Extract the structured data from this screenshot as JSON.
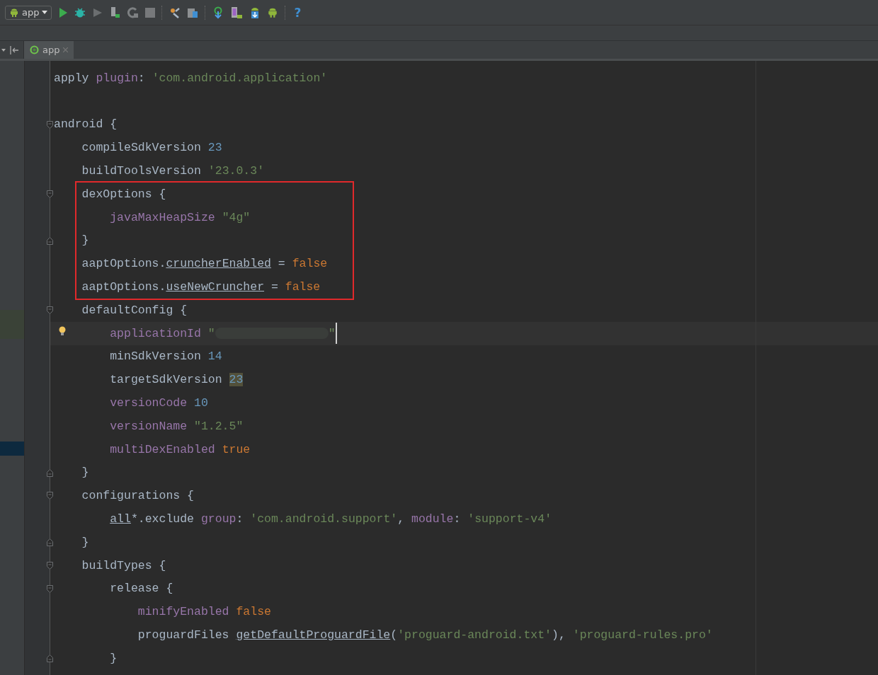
{
  "toolbar": {
    "run_config": "app",
    "help": "?"
  },
  "tabs": [
    {
      "label": "app",
      "selected": true
    }
  ],
  "editor": {
    "lines": [
      {
        "kind": "code",
        "tokens": [
          {
            "kind": "plain",
            "text": "apply "
          },
          {
            "kind": "field",
            "text": "plugin"
          },
          {
            "kind": "plain",
            "text": ": "
          },
          {
            "kind": "string",
            "text": "'com.android.application'"
          }
        ]
      },
      {
        "kind": "blank"
      },
      {
        "kind": "code",
        "tokens": [
          {
            "kind": "plain",
            "text": "android {"
          }
        ],
        "children": [
          {
            "kind": "code",
            "tokens": [
              {
                "kind": "plain",
                "text": "compileSdkVersion "
              },
              {
                "kind": "number",
                "text": "23"
              }
            ]
          },
          {
            "kind": "code",
            "tokens": [
              {
                "kind": "plain",
                "text": "buildToolsVersion "
              },
              {
                "kind": "string",
                "text": "'23.0.3'"
              }
            ]
          },
          {
            "kind": "highlight",
            "children": [
              {
                "kind": "code",
                "tokens": [
                  {
                    "kind": "plain",
                    "text": "dexOptions {"
                  }
                ],
                "closing": "}",
                "children": [
                  {
                    "kind": "code",
                    "tokens": [
                      {
                        "kind": "field",
                        "text": "javaMaxHeapSize "
                      },
                      {
                        "kind": "string",
                        "text": "\"4g\""
                      }
                    ]
                  }
                ]
              },
              {
                "kind": "code",
                "tokens": [
                  {
                    "kind": "plain",
                    "text": "aaptOptions."
                  },
                  {
                    "kind": "underlined",
                    "text": "cruncherEnabled"
                  },
                  {
                    "kind": "plain",
                    "text": " = "
                  },
                  {
                    "kind": "keyword",
                    "text": "false"
                  }
                ]
              },
              {
                "kind": "code",
                "tokens": [
                  {
                    "kind": "plain",
                    "text": "aaptOptions."
                  },
                  {
                    "kind": "underlined",
                    "text": "useNewCruncher"
                  },
                  {
                    "kind": "plain",
                    "text": " = "
                  },
                  {
                    "kind": "keyword",
                    "text": "false"
                  }
                ]
              }
            ]
          },
          {
            "kind": "code",
            "tokens": [
              {
                "kind": "plain",
                "text": "defaultConfig {"
              }
            ],
            "closing": "}",
            "children": [
              {
                "kind": "code",
                "current": true,
                "intention": true,
                "tokens": [
                  {
                    "kind": "field",
                    "text": "applicationId "
                  },
                  {
                    "kind": "string",
                    "text": "\""
                  },
                  {
                    "kind": "redacted"
                  },
                  {
                    "kind": "string",
                    "text": "\""
                  }
                ]
              },
              {
                "kind": "code",
                "tokens": [
                  {
                    "kind": "plain",
                    "text": "minSdkVersion "
                  },
                  {
                    "kind": "number",
                    "text": "14"
                  }
                ]
              },
              {
                "kind": "code",
                "tokens": [
                  {
                    "kind": "plain",
                    "text": "targetSdkVersion "
                  },
                  {
                    "kind": "marked",
                    "text": "23"
                  }
                ]
              },
              {
                "kind": "code",
                "tokens": [
                  {
                    "kind": "field",
                    "text": "versionCode "
                  },
                  {
                    "kind": "number",
                    "text": "10"
                  }
                ]
              },
              {
                "kind": "code",
                "tokens": [
                  {
                    "kind": "field",
                    "text": "versionName "
                  },
                  {
                    "kind": "string",
                    "text": "\"1.2.5\""
                  }
                ]
              },
              {
                "kind": "code",
                "tokens": [
                  {
                    "kind": "field",
                    "text": "multiDexEnabled "
                  },
                  {
                    "kind": "keyword",
                    "text": "true"
                  }
                ]
              }
            ]
          },
          {
            "kind": "code",
            "tokens": [
              {
                "kind": "plain",
                "text": "configurations {"
              }
            ],
            "closing": "}",
            "children": [
              {
                "kind": "code",
                "tokens": [
                  {
                    "kind": "underlined",
                    "text": "all"
                  },
                  {
                    "kind": "plain",
                    "text": "*.exclude "
                  },
                  {
                    "kind": "field",
                    "text": "group"
                  },
                  {
                    "kind": "plain",
                    "text": ": "
                  },
                  {
                    "kind": "string",
                    "text": "'com.android.support'"
                  },
                  {
                    "kind": "plain",
                    "text": ", "
                  },
                  {
                    "kind": "field",
                    "text": "module"
                  },
                  {
                    "kind": "plain",
                    "text": ": "
                  },
                  {
                    "kind": "string",
                    "text": "'support-v4'"
                  }
                ]
              }
            ]
          },
          {
            "kind": "code",
            "tokens": [
              {
                "kind": "plain",
                "text": "buildTypes {"
              }
            ],
            "children": [
              {
                "kind": "code",
                "tokens": [
                  {
                    "kind": "plain",
                    "text": "release {"
                  }
                ],
                "closing": "}",
                "children": [
                  {
                    "kind": "code",
                    "tokens": [
                      {
                        "kind": "field",
                        "text": "minifyEnabled "
                      },
                      {
                        "kind": "keyword",
                        "text": "false"
                      }
                    ]
                  },
                  {
                    "kind": "code",
                    "tokens": [
                      {
                        "kind": "plain",
                        "text": "proguardFiles "
                      },
                      {
                        "kind": "underlined",
                        "text": "getDefaultProguardFile"
                      },
                      {
                        "kind": "plain",
                        "text": "("
                      },
                      {
                        "kind": "string",
                        "text": "'proguard-android.txt'"
                      },
                      {
                        "kind": "plain",
                        "text": "), "
                      },
                      {
                        "kind": "string",
                        "text": "'proguard-rules.pro'"
                      }
                    ]
                  }
                ]
              }
            ]
          }
        ]
      }
    ]
  }
}
